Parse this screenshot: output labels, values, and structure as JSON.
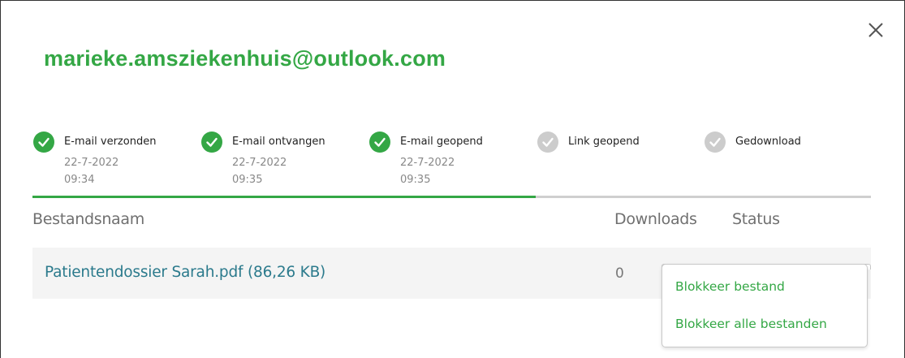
{
  "recipient_email": "marieke.amsziekenhuis@outlook.com",
  "colors": {
    "accent": "#34a745",
    "inactive": "#cccccc",
    "link": "#2b7a8c"
  },
  "steps": [
    {
      "label": "E-mail verzonden",
      "date": "22-7-2022",
      "time": "09:34",
      "done": true
    },
    {
      "label": "E-mail ontvangen",
      "date": "22-7-2022",
      "time": "09:35",
      "done": true
    },
    {
      "label": "E-mail geopend",
      "date": "22-7-2022",
      "time": "09:35",
      "done": true
    },
    {
      "label": "Link geopend",
      "date": "",
      "time": "",
      "done": false
    },
    {
      "label": "Gedownload",
      "date": "",
      "time": "",
      "done": false
    }
  ],
  "progress": {
    "completed_steps": 3,
    "total_steps": 5,
    "fraction": 0.6
  },
  "table": {
    "headers": {
      "filename": "Bestandsnaam",
      "downloads": "Downloads",
      "status": "Status"
    },
    "rows": [
      {
        "filename": "Patientendossier Sarah.pdf (86,26 KB)",
        "downloads": "0"
      }
    ]
  },
  "status_menu": {
    "items": [
      {
        "label": "Blokkeer bestand"
      },
      {
        "label": "Blokkeer alle bestanden"
      }
    ]
  },
  "icons": {
    "close": "close-icon",
    "step_done": "checkmark-icon",
    "step_pending": "checkmark-icon-inactive"
  }
}
